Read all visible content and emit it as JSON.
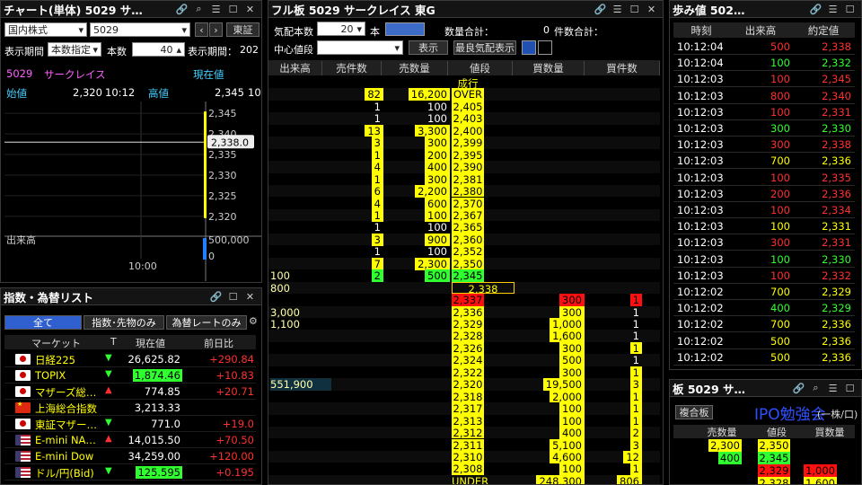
{
  "chart": {
    "title": "チャート(単体) 5029 サ…",
    "market": "国内株式",
    "code": "5029",
    "exchange": "東証",
    "period_label": "表示期間",
    "period_value": "本数指定",
    "count_label": "本数",
    "count_value": "40",
    "period_label2": "表示期間：",
    "period_value2": "202",
    "symbol": "5029",
    "name": "サークレイス",
    "current_label": "現在値",
    "open_label": "始値",
    "open_value": "2,320",
    "open_time": "10:12",
    "high_label": "高値",
    "high_value": "2,345",
    "high_extra": "10",
    "volume_label": "出来高",
    "volume_tick": "500,000",
    "volume_zero": "0",
    "time_tick": "10:00",
    "price_badge": "2,338.0",
    "price_ticks": [
      "2,345",
      "2,340",
      "2,335",
      "2,330",
      "2,325",
      "2,320"
    ]
  },
  "chart_data": {
    "type": "line",
    "x": [
      "10:00",
      "10:12"
    ],
    "y_ticks": [
      2345,
      2340,
      2335,
      2330,
      2325,
      2320
    ],
    "current": 2338.0,
    "ylim": [
      2318,
      2347
    ],
    "volume_ticks": [
      0,
      500000
    ]
  },
  "index": {
    "title": "指数・為替リスト",
    "tabs": [
      "全て",
      "指数･先物のみ",
      "為替レートのみ"
    ],
    "headers": [
      "マーケット",
      "T",
      "現在値",
      "前日比"
    ],
    "rows": [
      {
        "name": "日経225",
        "dir": "down",
        "value": "26,625.82",
        "change": "+290.84",
        "flag": "jp",
        "hl": ""
      },
      {
        "name": "TOPIX",
        "dir": "down",
        "value": "1,874.46",
        "change": "+10.83",
        "flag": "jp",
        "hl": "g"
      },
      {
        "name": "マザーズ総…",
        "dir": "up",
        "value": "774.85",
        "change": "+20.71",
        "flag": "jp",
        "hl": ""
      },
      {
        "name": "上海総合指数",
        "dir": "",
        "value": "3,213.33",
        "change": "",
        "flag": "cn",
        "hl": ""
      },
      {
        "name": "東証マザー…",
        "dir": "down",
        "value": "771.0",
        "change": "+19.0",
        "flag": "jp",
        "hl": ""
      },
      {
        "name": "E-mini NA…",
        "dir": "up",
        "value": "14,015.50",
        "change": "+70.50",
        "flag": "us",
        "hl": ""
      },
      {
        "name": "E-mini Dow",
        "dir": "",
        "value": "34,259.00",
        "change": "+120.00",
        "flag": "us",
        "hl": ""
      },
      {
        "name": "ドル/円(Bid)",
        "dir": "down",
        "value": "125.595",
        "change": "+0.195",
        "flag": "usjp",
        "hl": "g"
      }
    ]
  },
  "board": {
    "title": "フル板 5029 サークレイス 東G",
    "depth_label": "気配本数",
    "depth_value": "20",
    "depth_unit": "本",
    "qty_total_label": "数量合計：",
    "qty_total_value": "0",
    "count_total_label": "件数合計：",
    "center_label": "中心値段",
    "show_btn": "表示",
    "best_btn": "最良気配表示",
    "headers": [
      "出来高",
      "売件数",
      "売数量",
      "値段",
      "買数量",
      "買件数"
    ],
    "rows": [
      {
        "vol": "",
        "sc": "",
        "sq": "",
        "p": "成行",
        "bq": "",
        "bc": "",
        "pt": "plain"
      },
      {
        "vol": "",
        "sc": "82",
        "sq": "16,200",
        "p": "OVER",
        "bq": "",
        "bc": "",
        "pt": "y",
        "sb": "y"
      },
      {
        "vol": "",
        "sc": "1",
        "sq": "100",
        "p": "2,405",
        "bq": "",
        "bc": "",
        "pt": "y",
        "sb": "p"
      },
      {
        "vol": "",
        "sc": "1",
        "sq": "100",
        "p": "2,403",
        "bq": "",
        "bc": "",
        "pt": "y",
        "sb": "p"
      },
      {
        "vol": "",
        "sc": "13",
        "sq": "3,300",
        "p": "2,400",
        "bq": "",
        "bc": "",
        "pt": "y",
        "sb": "y"
      },
      {
        "vol": "",
        "sc": "3",
        "sq": "300",
        "p": "2,399",
        "bq": "",
        "bc": "",
        "pt": "y",
        "sb": "y"
      },
      {
        "vol": "",
        "sc": "1",
        "sq": "200",
        "p": "2,395",
        "bq": "",
        "bc": "",
        "pt": "y",
        "sb": "y"
      },
      {
        "vol": "",
        "sc": "4",
        "sq": "400",
        "p": "2,390",
        "bq": "",
        "bc": "",
        "pt": "y",
        "sb": "y"
      },
      {
        "vol": "",
        "sc": "1",
        "sq": "300",
        "p": "2,381",
        "bq": "",
        "bc": "",
        "pt": "y",
        "sb": "y"
      },
      {
        "vol": "",
        "sc": "6",
        "sq": "2,200",
        "p": "2,380",
        "bq": "",
        "bc": "",
        "pt": "y",
        "sb": "y"
      },
      {
        "vol": "",
        "sc": "4",
        "sq": "600",
        "p": "2,370",
        "bq": "",
        "bc": "",
        "pt": "y",
        "sb": "y"
      },
      {
        "vol": "",
        "sc": "1",
        "sq": "100",
        "p": "2,367",
        "bq": "",
        "bc": "",
        "pt": "y",
        "sb": "y"
      },
      {
        "vol": "",
        "sc": "1",
        "sq": "100",
        "p": "2,365",
        "bq": "",
        "bc": "",
        "pt": "y",
        "sb": "p"
      },
      {
        "vol": "",
        "sc": "3",
        "sq": "900",
        "p": "2,360",
        "bq": "",
        "bc": "",
        "pt": "y",
        "sb": "y"
      },
      {
        "vol": "",
        "sc": "1",
        "sq": "100",
        "p": "2,352",
        "bq": "",
        "bc": "",
        "pt": "y",
        "sb": "p"
      },
      {
        "vol": "",
        "sc": "7",
        "sq": "2,300",
        "p": "2,350",
        "bq": "",
        "bc": "",
        "pt": "y",
        "sb": "y"
      },
      {
        "vol": "100",
        "sc": "2",
        "sq": "500",
        "p": "2,345",
        "bq": "",
        "bc": "",
        "pt": "g",
        "sb": "g"
      },
      {
        "vol": "800",
        "sc": "",
        "sq": "",
        "p": "2,338",
        "bq": "",
        "bc": "",
        "pt": "o"
      },
      {
        "vol": "",
        "sc": "",
        "sq": "",
        "p": "2,337",
        "bq": "300",
        "bc": "1",
        "pt": "r",
        "bb": "r"
      },
      {
        "vol": "3,000",
        "sc": "",
        "sq": "",
        "p": "2,336",
        "bq": "300",
        "bc": "1",
        "pt": "y",
        "bb": "y",
        "bcp": "p"
      },
      {
        "vol": "1,100",
        "sc": "",
        "sq": "",
        "p": "2,329",
        "bq": "1,000",
        "bc": "1",
        "pt": "y",
        "bb": "y",
        "bcp": "p"
      },
      {
        "vol": "",
        "sc": "",
        "sq": "",
        "p": "2,328",
        "bq": "1,600",
        "bc": "1",
        "pt": "y",
        "bb": "y",
        "bcp": "p"
      },
      {
        "vol": "",
        "sc": "",
        "sq": "",
        "p": "2,326",
        "bq": "300",
        "bc": "1",
        "pt": "y",
        "bb": "y"
      },
      {
        "vol": "",
        "sc": "",
        "sq": "",
        "p": "2,324",
        "bq": "500",
        "bc": "1",
        "pt": "y",
        "bb": "y",
        "bcp": "p"
      },
      {
        "vol": "",
        "sc": "",
        "sq": "",
        "p": "2,322",
        "bq": "300",
        "bc": "1",
        "pt": "y",
        "bb": "y"
      },
      {
        "vol": "551,900",
        "sc": "",
        "sq": "",
        "p": "2,320",
        "bq": "19,500",
        "bc": "3",
        "pt": "y",
        "bb": "y",
        "vb": "1"
      },
      {
        "vol": "",
        "sc": "",
        "sq": "",
        "p": "2,318",
        "bq": "2,000",
        "bc": "1",
        "pt": "y",
        "bb": "y"
      },
      {
        "vol": "",
        "sc": "",
        "sq": "",
        "p": "2,317",
        "bq": "100",
        "bc": "1",
        "pt": "y",
        "bb": "y"
      },
      {
        "vol": "",
        "sc": "",
        "sq": "",
        "p": "2,313",
        "bq": "100",
        "bc": "1",
        "pt": "y",
        "bb": "y"
      },
      {
        "vol": "",
        "sc": "",
        "sq": "",
        "p": "2,312",
        "bq": "400",
        "bc": "2",
        "pt": "y",
        "bb": "y"
      },
      {
        "vol": "",
        "sc": "",
        "sq": "",
        "p": "2,311",
        "bq": "5,100",
        "bc": "3",
        "pt": "y",
        "bb": "y"
      },
      {
        "vol": "",
        "sc": "",
        "sq": "",
        "p": "2,310",
        "bq": "4,600",
        "bc": "12",
        "pt": "y",
        "bb": "y"
      },
      {
        "vol": "",
        "sc": "",
        "sq": "",
        "p": "2,308",
        "bq": "100",
        "bc": "1",
        "pt": "y",
        "bb": "y"
      },
      {
        "vol": "",
        "sc": "",
        "sq": "",
        "p": "UNDER",
        "bq": "248,300",
        "bc": "806",
        "pt": "plain",
        "bb": "y"
      }
    ]
  },
  "ticks": {
    "title": "歩み値 502…",
    "headers": [
      "時刻",
      "出来高",
      "約定値"
    ],
    "rows": [
      {
        "t": "10:12:04",
        "v": "500",
        "p": "2,338",
        "c": "r"
      },
      {
        "t": "10:12:04",
        "v": "100",
        "p": "2,332",
        "c": "g"
      },
      {
        "t": "10:12:03",
        "v": "100",
        "p": "2,345",
        "c": "r"
      },
      {
        "t": "10:12:03",
        "v": "800",
        "p": "2,340",
        "c": "r"
      },
      {
        "t": "10:12:03",
        "v": "100",
        "p": "2,331",
        "c": "r"
      },
      {
        "t": "10:12:03",
        "v": "300",
        "p": "2,330",
        "c": "g"
      },
      {
        "t": "10:12:03",
        "v": "300",
        "p": "2,338",
        "c": "r"
      },
      {
        "t": "10:12:03",
        "v": "700",
        "p": "2,336",
        "c": "y"
      },
      {
        "t": "10:12:03",
        "v": "100",
        "p": "2,335",
        "c": "r"
      },
      {
        "t": "10:12:03",
        "v": "200",
        "p": "2,336",
        "c": "r"
      },
      {
        "t": "10:12:03",
        "v": "100",
        "p": "2,334",
        "c": "r"
      },
      {
        "t": "10:12:03",
        "v": "100",
        "p": "2,331",
        "c": "y"
      },
      {
        "t": "10:12:03",
        "v": "300",
        "p": "2,331",
        "c": "r"
      },
      {
        "t": "10:12:03",
        "v": "100",
        "p": "2,330",
        "c": "g"
      },
      {
        "t": "10:12:03",
        "v": "100",
        "p": "2,332",
        "c": "r"
      },
      {
        "t": "10:12:02",
        "v": "700",
        "p": "2,329",
        "c": "y"
      },
      {
        "t": "10:12:02",
        "v": "400",
        "p": "2,329",
        "c": "g"
      },
      {
        "t": "10:12:02",
        "v": "700",
        "p": "2,336",
        "c": "y"
      },
      {
        "t": "10:12:02",
        "v": "500",
        "p": "2,336",
        "c": "y"
      },
      {
        "t": "10:12:02",
        "v": "500",
        "p": "2,336",
        "c": "y"
      }
    ]
  },
  "mini": {
    "title": "板 5029 サ…",
    "btn": "複合板",
    "watermark": "IPO勉強会",
    "unit": "(一株/口)",
    "headers": [
      "売数量",
      "値段",
      "買数量"
    ],
    "rows": [
      {
        "sq": "2,300",
        "p": "2,350",
        "bq": "",
        "pt": "y"
      },
      {
        "sq": "400",
        "p": "2,345",
        "bq": "",
        "pt": "g"
      },
      {
        "sq": "",
        "p": "2,329",
        "bq": "1,000",
        "pt": "r"
      },
      {
        "sq": "",
        "p": "2,328",
        "bq": "1,600",
        "pt": "y"
      }
    ]
  }
}
